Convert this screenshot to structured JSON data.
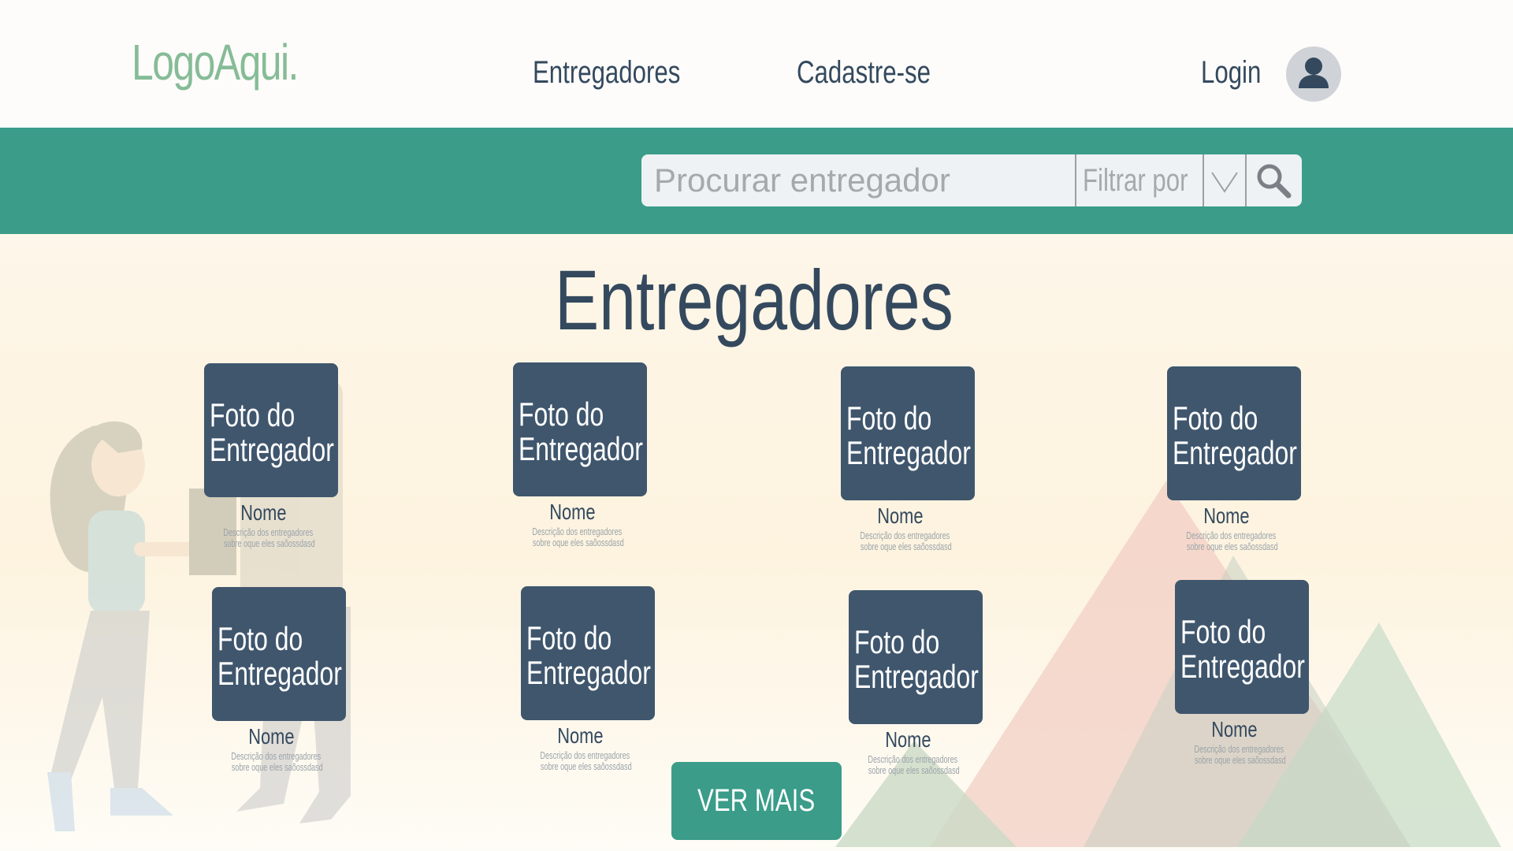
{
  "header": {
    "logo": "LogoAqui.",
    "nav": [
      "Entregadores",
      "Cadastre-se"
    ],
    "login": "Login"
  },
  "search": {
    "placeholder": "Procurar entregador",
    "filter_label": "Filtrar por"
  },
  "section": {
    "title": "Entregadores"
  },
  "cards": [
    {
      "photo_line1": "Foto do",
      "photo_line2": "Entregador",
      "name": "Nome",
      "desc_line1": "Descrição dos entregadores",
      "desc_line2": "sobre oque eles saõossdasd"
    },
    {
      "photo_line1": "Foto do",
      "photo_line2": "Entregador",
      "name": "Nome",
      "desc_line1": "Descrição dos entregadores",
      "desc_line2": "sobre oque eles saõossdasd"
    },
    {
      "photo_line1": "Foto do",
      "photo_line2": "Entregador",
      "name": "Nome",
      "desc_line1": "Descrição dos entregadores",
      "desc_line2": "sobre oque eles saõossdasd"
    },
    {
      "photo_line1": "Foto do",
      "photo_line2": "Entregador",
      "name": "Nome",
      "desc_line1": "Descrição dos entregadores",
      "desc_line2": "sobre oque eles saõossdasd"
    },
    {
      "photo_line1": "Foto do",
      "photo_line2": "Entregador",
      "name": "Nome",
      "desc_line1": "Descrição dos entregadores",
      "desc_line2": "sobre oque eles saõossdasd"
    },
    {
      "photo_line1": "Foto do",
      "photo_line2": "Entregador",
      "name": "Nome",
      "desc_line1": "Descrição dos entregadores",
      "desc_line2": "sobre oque eles saõossdasd"
    },
    {
      "photo_line1": "Foto do",
      "photo_line2": "Entregador",
      "name": "Nome",
      "desc_line1": "Descrição dos entregadores",
      "desc_line2": "sobre oque eles saõossdasd"
    },
    {
      "photo_line1": "Foto do",
      "photo_line2": "Entregador",
      "name": "Nome",
      "desc_line1": "Descrição dos entregadores",
      "desc_line2": "sobre oque eles saõossdasd"
    }
  ],
  "button": {
    "label": "VER MAIS"
  },
  "icons": {
    "avatar": "user-icon",
    "dropdown": "chevron-down-icon",
    "search": "search-icon"
  },
  "colors": {
    "primary": "#3a9c89",
    "logo": "#86bc97",
    "text": "#34495e",
    "card": "#3f566d"
  }
}
